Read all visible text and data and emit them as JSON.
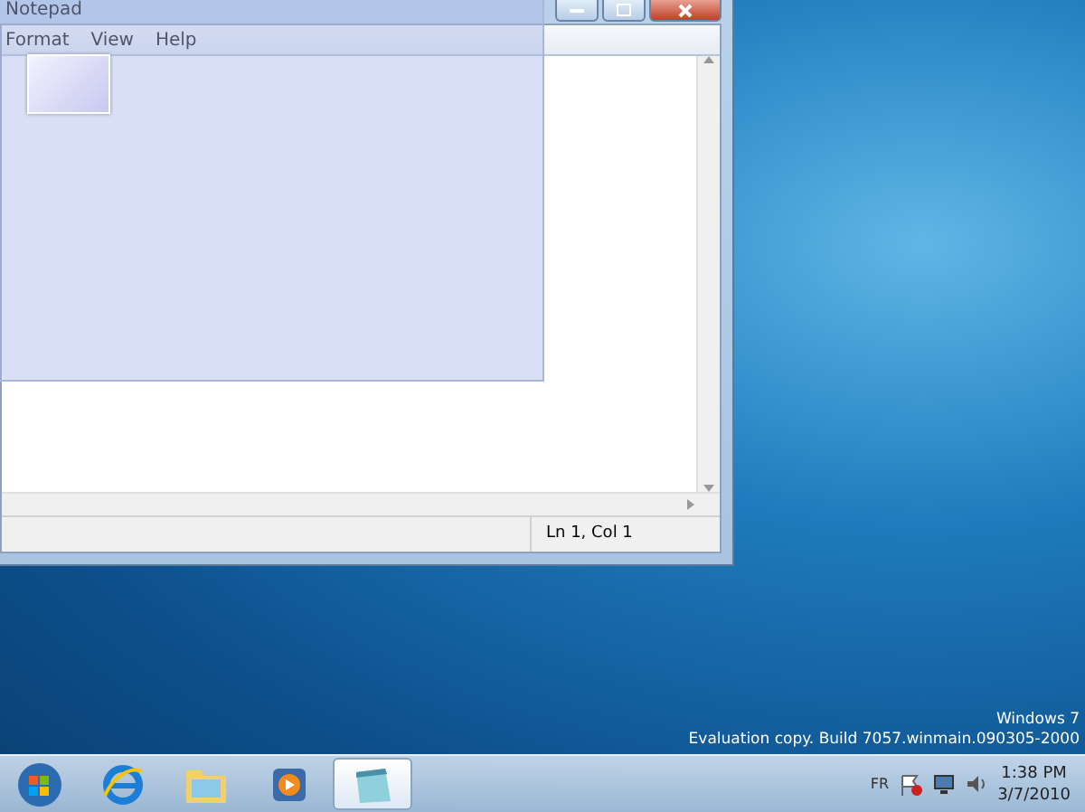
{
  "window": {
    "title": "Notepad",
    "menu": [
      "Format",
      "View",
      "Help"
    ],
    "status_bar": {
      "position": "Ln 1, Col 1"
    }
  },
  "desktop": {
    "edition": "Windows 7",
    "build": "Evaluation copy. Build 7057.winmain.090305-2000"
  },
  "taskbar": {
    "apps": [
      {
        "kind": "start",
        "selected": false
      },
      {
        "kind": "browser",
        "selected": false
      },
      {
        "kind": "folder",
        "selected": false
      },
      {
        "kind": "media",
        "selected": false
      },
      {
        "kind": "notepad",
        "selected": true
      }
    ],
    "tray": {
      "language": "FR",
      "time": "1:38 PM",
      "date": "3/7/2010"
    }
  }
}
